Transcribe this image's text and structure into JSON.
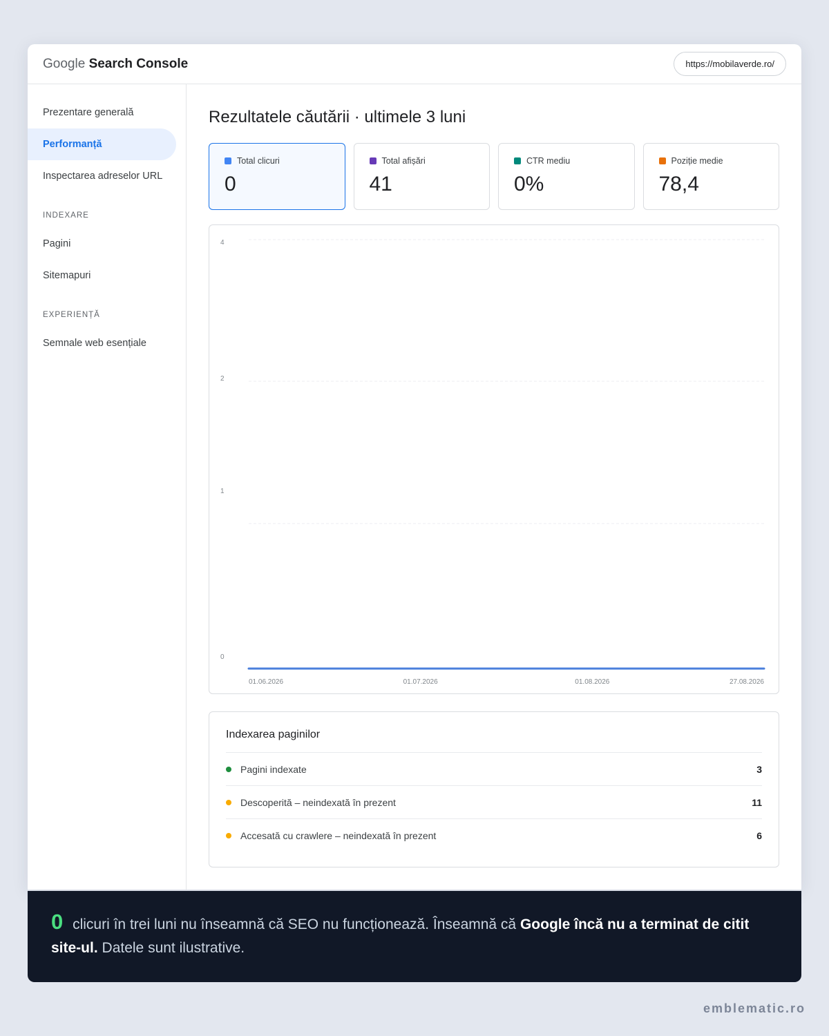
{
  "brand": {
    "prefix": "Google",
    "name": "Search Console"
  },
  "property_url": "https://mobilaverde.ro/",
  "sidebar": {
    "items": [
      {
        "label": "Prezentare generală"
      },
      {
        "label": "Performanță"
      },
      {
        "label": "Inspectarea adreselor URL"
      }
    ],
    "sections": [
      {
        "title": "INDEXARE",
        "items": [
          {
            "label": "Pagini"
          },
          {
            "label": "Sitemapuri"
          }
        ]
      },
      {
        "title": "EXPERIENȚĂ",
        "items": [
          {
            "label": "Semnale web esențiale"
          }
        ]
      }
    ]
  },
  "main": {
    "title": "Rezultatele căutării · ultimele 3 luni",
    "metrics": [
      {
        "label": "Total clicuri",
        "value": "0",
        "color": "#4285f4"
      },
      {
        "label": "Total afișări",
        "value": "41",
        "color": "#673ab7"
      },
      {
        "label": "CTR mediu",
        "value": "0%",
        "color": "#00897b"
      },
      {
        "label": "Poziție medie",
        "value": "78,4",
        "color": "#e8710a"
      }
    ]
  },
  "chart_data": {
    "type": "line",
    "x": [
      "01.06.2026",
      "01.07.2026",
      "01.08.2026",
      "27.08.2026"
    ],
    "series": [
      {
        "values": [
          0,
          0,
          0,
          0
        ],
        "color": "#4a7fdc"
      }
    ],
    "yticks": [
      "4",
      "2",
      "1",
      "0"
    ],
    "ylim": [
      0,
      4
    ],
    "grid": true
  },
  "indexing": {
    "title": "Indexarea paginilor",
    "rows": [
      {
        "label": "Pagini indexate",
        "value": "3",
        "color": "#1e8e3e"
      },
      {
        "label": "Descoperită – neindexată în prezent",
        "value": "11",
        "color": "#f9ab00"
      },
      {
        "label": "Accesată cu crawlere – neindexată în prezent",
        "value": "6",
        "color": "#f9ab00"
      }
    ]
  },
  "banner": {
    "big": "0",
    "text1": "clicuri în trei luni nu înseamnă că SEO nu funcționează. Înseamnă că",
    "bold": "Google încă nu a terminat de citit site-ul.",
    "text2": "Datele sunt ilustrative."
  },
  "footer": "emblematic.ro"
}
